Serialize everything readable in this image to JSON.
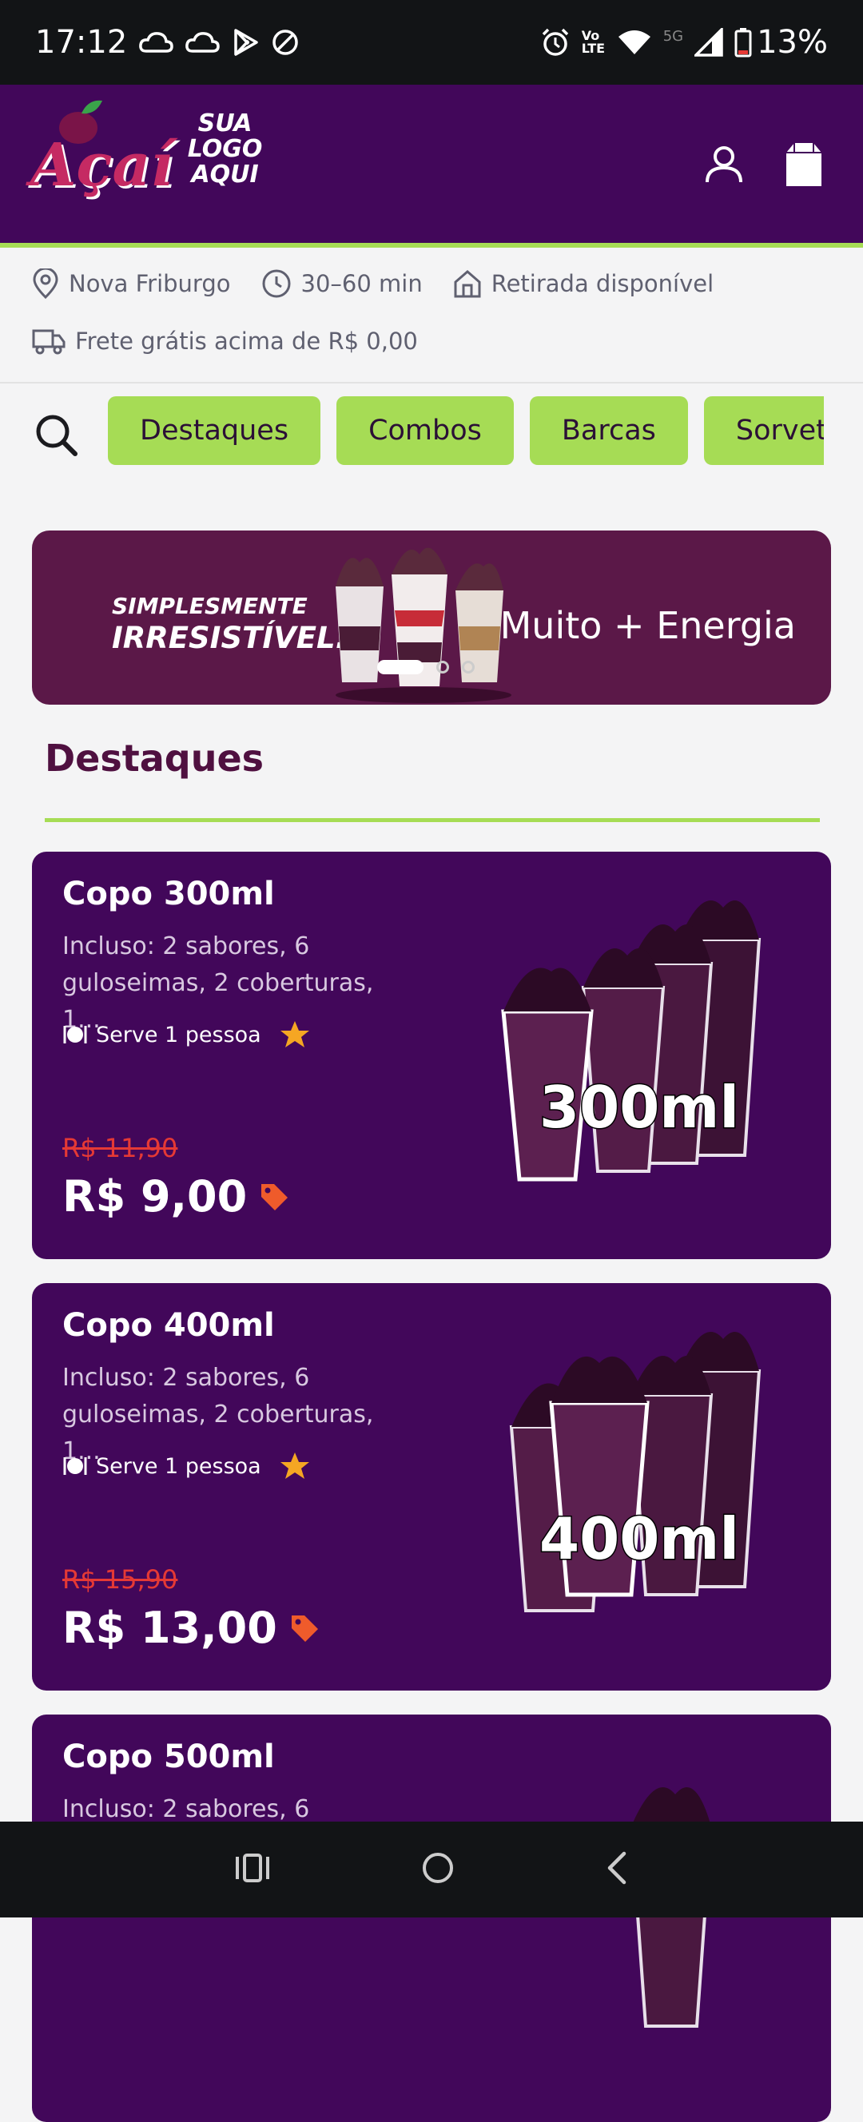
{
  "status_bar": {
    "time": "17:12",
    "battery": "13%",
    "network": "5G",
    "volte": "Vo LTE"
  },
  "header": {
    "logo_word": "Açaí",
    "logo_text": "SUA LOGO AQUI"
  },
  "info": {
    "location": "Nova Friburgo",
    "delivery_time": "30–60 min",
    "pickup": "Retirada disponível",
    "shipping": "Frete grátis acima de R$ 0,00"
  },
  "categories": [
    "Destaques",
    "Combos",
    "Barcas",
    "Sorvetes"
  ],
  "banner": {
    "tagline_1": "SIMPLESMENTE",
    "tagline_2": "IRRESISTÍVEL...",
    "slogan": "Muito + Energia",
    "slides": 3,
    "active_slide": 1
  },
  "section": {
    "title": "Destaques"
  },
  "products": [
    {
      "name": "Copo 300ml",
      "description": "Incluso: 2 sabores, 6 guloseimas, 2 coberturas, 1...",
      "serves": "Serve 1 pessoa",
      "old_price": "R$ 11,90",
      "price": "R$ 9,00",
      "image_label": "300ml"
    },
    {
      "name": "Copo 400ml",
      "description": "Incluso: 2 sabores, 6 guloseimas, 2 coberturas, 1...",
      "serves": "Serve 1 pessoa",
      "old_price": "R$ 15,90",
      "price": "R$ 13,00",
      "image_label": "400ml"
    },
    {
      "name": "Copo 500ml",
      "description": "Incluso: 2 sabores, 6"
    }
  ],
  "colors": {
    "primary": "#42075a",
    "accent": "#a6dc55",
    "banner": "#5b1848",
    "strike_price": "#e53935",
    "tag": "#ef5b2b",
    "star": "#f5a623"
  }
}
